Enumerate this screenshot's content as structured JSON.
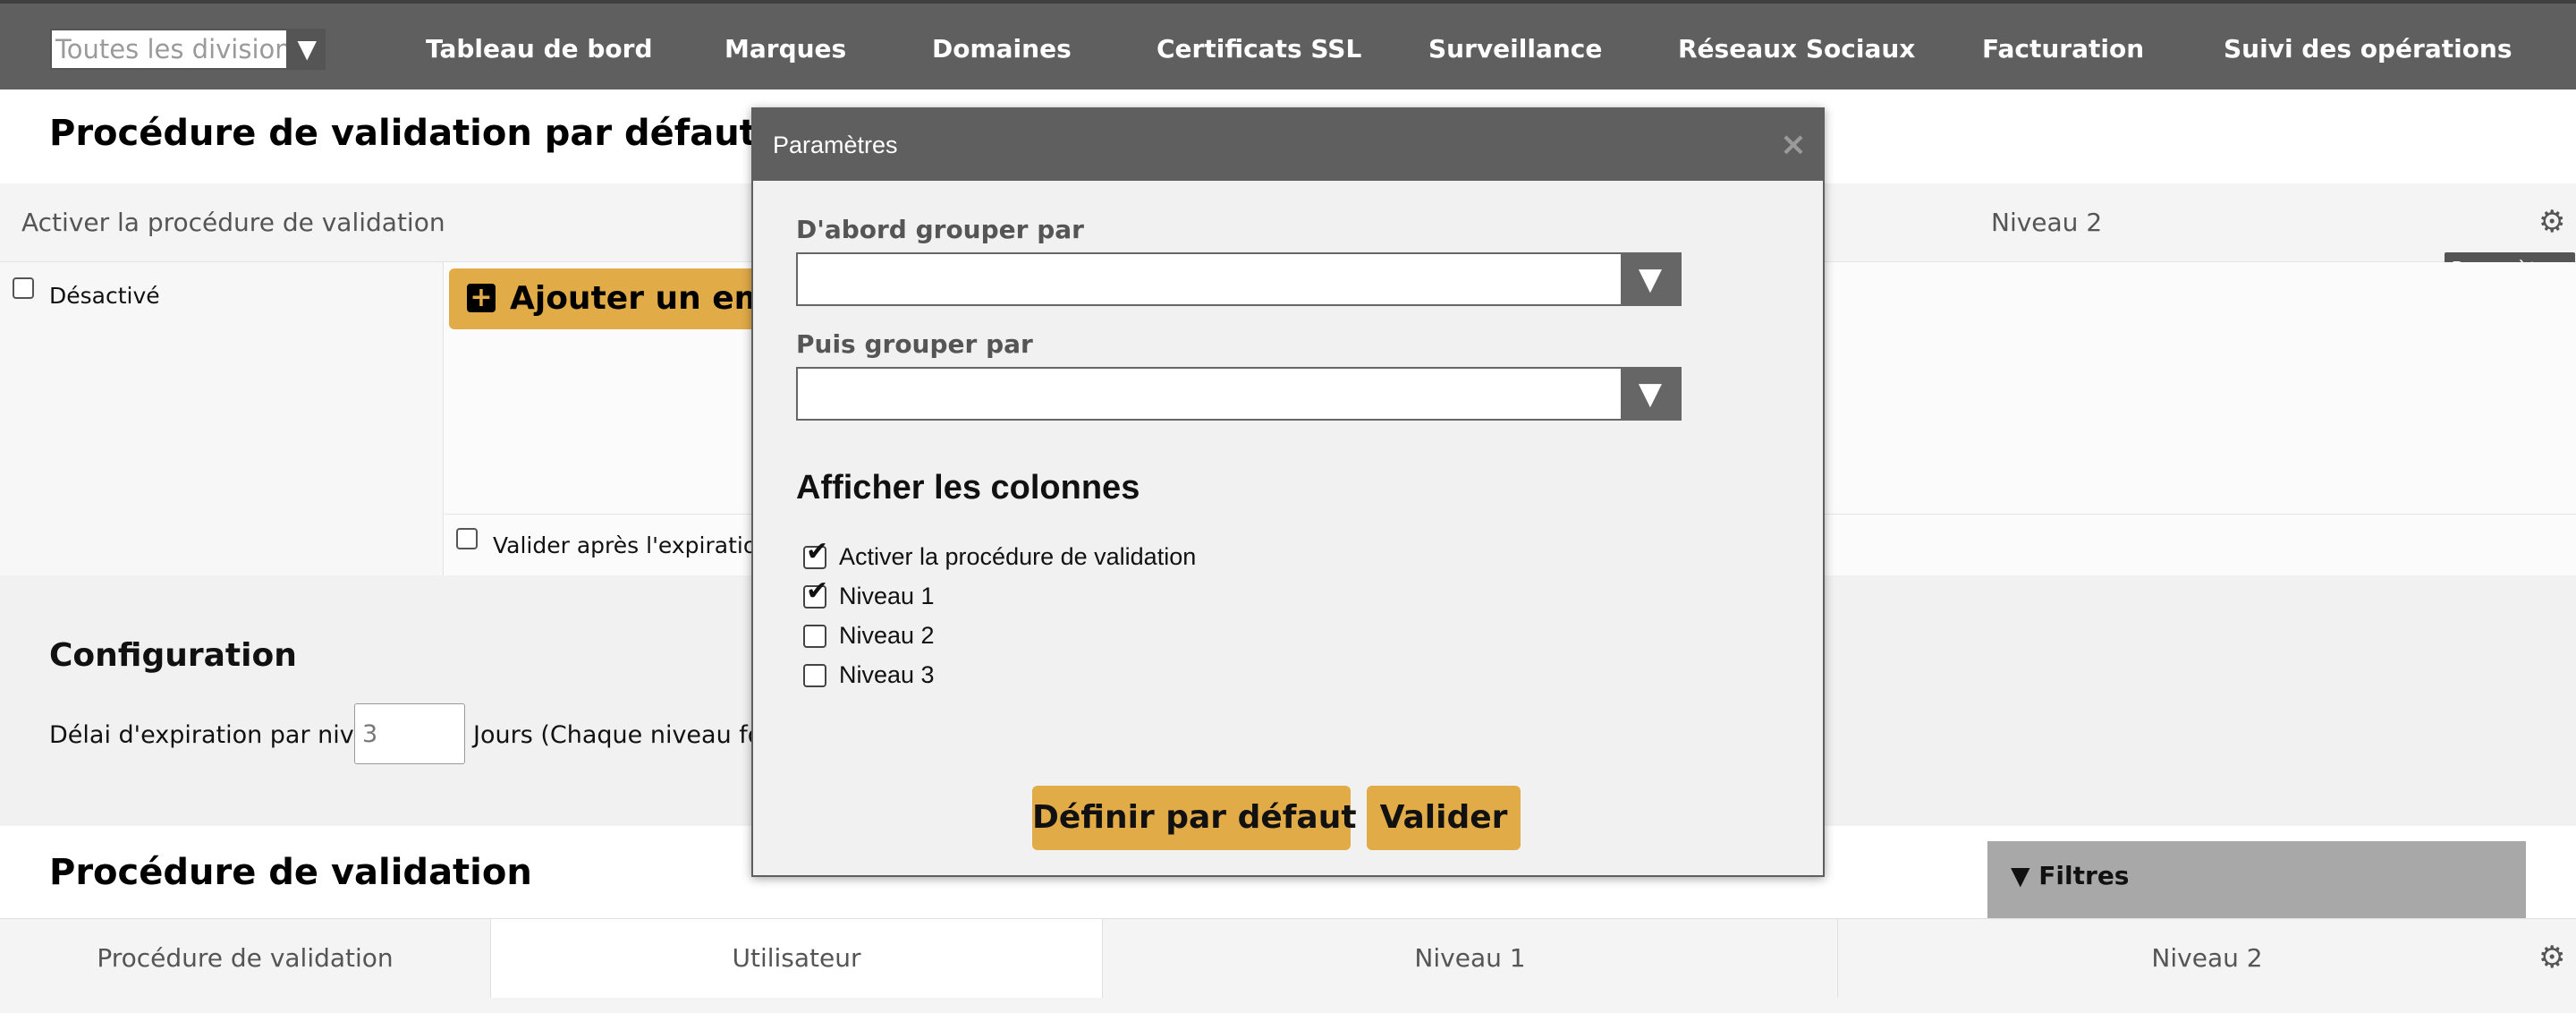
{
  "topnav": {
    "division_select": {
      "value": "Toutes les divisions"
    },
    "items": [
      "Tableau de bord",
      "Marques",
      "Domaines",
      "Certificats SSL",
      "Surveillance",
      "Réseaux Sociaux",
      "Facturation",
      "Suivi des opérations"
    ]
  },
  "page": {
    "title1": "Procédure de validation par défaut du d",
    "grid1": {
      "col_activate": "Activer la procédure de validation",
      "col_level2": "Niveau 2",
      "tooltip": "Paramètres",
      "disabled_label": "Désactivé",
      "add_button": "Ajouter un ema",
      "validate_after_expiry": "Valider après l'expiration ?"
    },
    "config": {
      "title": "Configuration",
      "expiry_label": "Délai d'expiration par niveau",
      "expiry_value": "3",
      "expiry_suffix": "Jours (Chaque niveau fonc"
    },
    "title2": "Procédure de validation",
    "filters": {
      "label": "Filtres"
    },
    "grid2": {
      "columns": [
        "Procédure de validation",
        "Utilisateur",
        "Niveau 1",
        "Niveau 2"
      ]
    }
  },
  "modal": {
    "title": "Paramètres",
    "close": "×",
    "first_group_label": "D'abord grouper par",
    "first_group_value": "",
    "then_group_label": "Puis grouper par",
    "then_group_value": "",
    "columns_title": "Afficher les colonnes",
    "columns": [
      {
        "label": "Activer la procédure de validation",
        "checked": true
      },
      {
        "label": "Niveau 1",
        "checked": true
      },
      {
        "label": "Niveau 2",
        "checked": false
      },
      {
        "label": "Niveau 3",
        "checked": false
      }
    ],
    "default_button": "Définir par défaut",
    "validate_button": "Valider"
  }
}
